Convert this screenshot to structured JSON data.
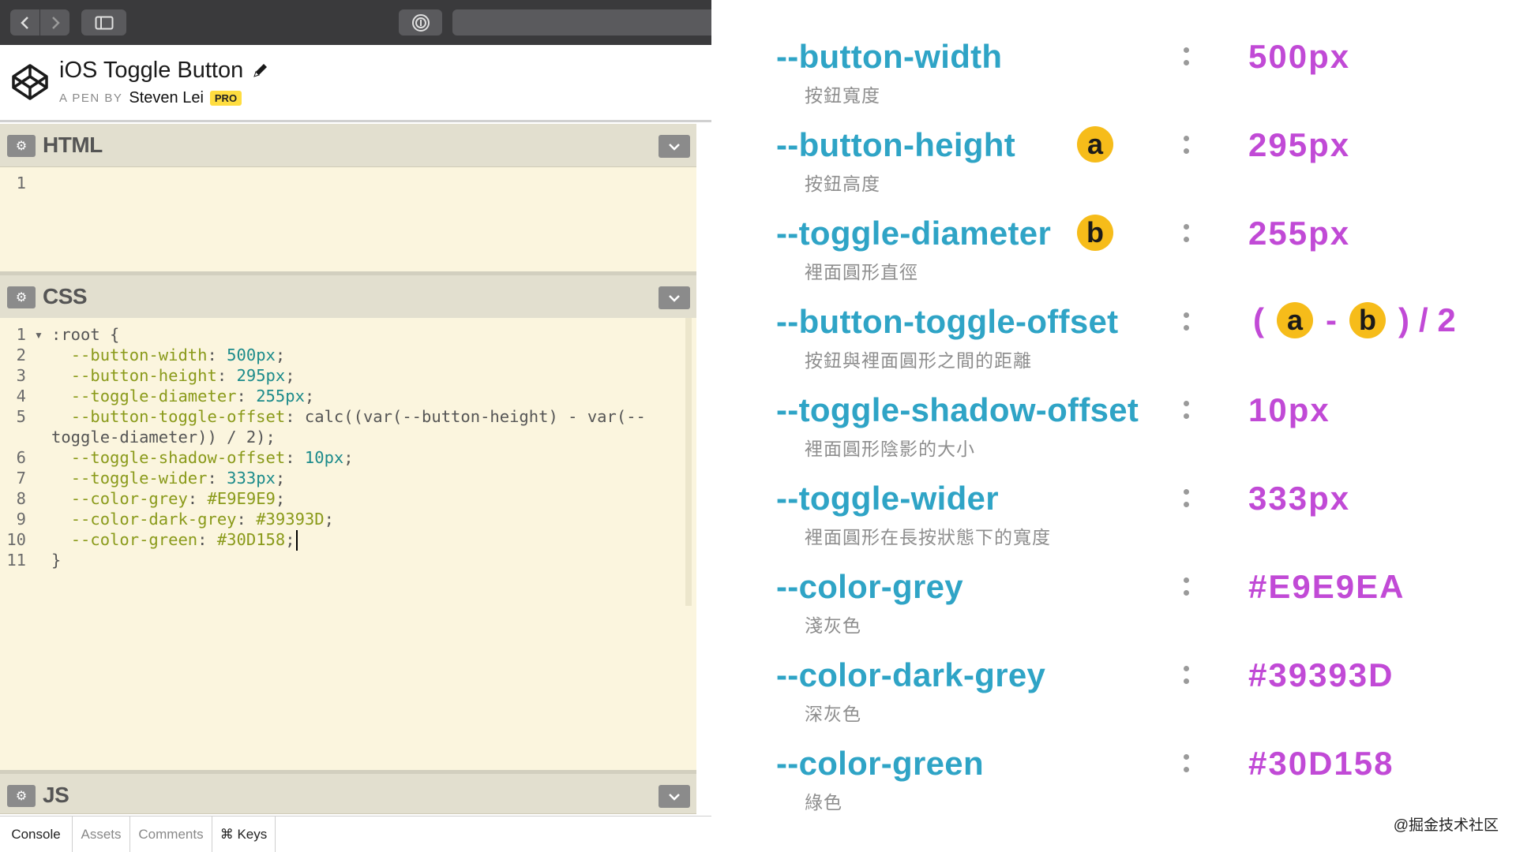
{
  "pen": {
    "title": "iOS Toggle Button",
    "by_label": "A PEN BY",
    "author": "Steven Lei",
    "badge": "PRO"
  },
  "panels": {
    "html": {
      "title": "HTML",
      "lines": [
        "1"
      ]
    },
    "css": {
      "title": "CSS"
    },
    "js": {
      "title": "JS"
    }
  },
  "css_code": [
    {
      "num": "1",
      "text": ":root {"
    },
    {
      "num": "2",
      "prop": "--button-width",
      "value": "500px"
    },
    {
      "num": "3",
      "prop": "--button-height",
      "value": "295px"
    },
    {
      "num": "4",
      "prop": "--toggle-diameter",
      "value": "255px"
    },
    {
      "num": "5",
      "prop": "--button-toggle-offset",
      "value": "calc((var(--button-height) - var(--",
      "cont": "toggle-diameter)) / 2);"
    },
    {
      "num": "6",
      "prop": "--toggle-shadow-offset",
      "value": "10px"
    },
    {
      "num": "7",
      "prop": "--toggle-wider",
      "value": "333px"
    },
    {
      "num": "8",
      "prop": "--color-grey",
      "value": "#E9E9E9"
    },
    {
      "num": "9",
      "prop": "--color-dark-grey",
      "value": "#39393D"
    },
    {
      "num": "10",
      "prop": "--color-green",
      "value": "#30D158"
    },
    {
      "num": "11",
      "text": "}"
    }
  ],
  "bottom_tabs": [
    "Console",
    "Assets",
    "Comments",
    "⌘ Keys"
  ],
  "variables": [
    {
      "name": "--button-width",
      "desc": "按鈕寬度",
      "value": "500px"
    },
    {
      "name": "--button-height",
      "desc": "按鈕高度",
      "value": "295px",
      "marker": "a"
    },
    {
      "name": "--toggle-diameter",
      "desc": "裡面圓形直徑",
      "value": "255px",
      "marker": "b"
    },
    {
      "name": "--button-toggle-offset",
      "desc": "按鈕與裡面圓形之間的距離",
      "formula": {
        "open": "(",
        "a": "a",
        "minus": "-",
        "b": "b",
        "close": ")",
        "div": "/ 2"
      }
    },
    {
      "name": "--toggle-shadow-offset",
      "desc": "裡面圓形陰影的大小",
      "value": "10px"
    },
    {
      "name": "--toggle-wider",
      "desc": "裡面圓形在長按狀態下的寬度",
      "value": "333px"
    },
    {
      "name": "--color-grey",
      "desc": "淺灰色",
      "value": "#E9E9EA"
    },
    {
      "name": "--color-dark-grey",
      "desc": "深灰色",
      "value": "#39393D"
    },
    {
      "name": "--color-green",
      "desc": "綠色",
      "value": "#30D158"
    }
  ],
  "watermark": "@掘金技术社区",
  "colors": {
    "var_name": "#2fa4c6",
    "var_value": "#c14ad6",
    "marker": "#f6bc1a",
    "editor_bg": "#fbf5de",
    "panel_header": "#e2dfcf"
  }
}
